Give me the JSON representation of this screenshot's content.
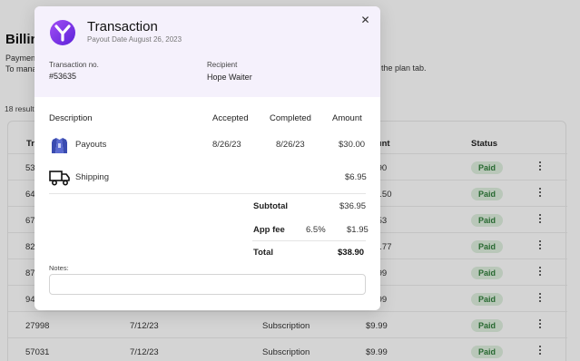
{
  "background": {
    "title": "Billin",
    "desc_line1": "Paymen",
    "desc_line2": "To mana",
    "desc_right": "the plan tab.",
    "results_count": "18 result",
    "headers": {
      "id": "Tra",
      "amount": "ount",
      "status": "Status"
    },
    "rows": [
      {
        "id": "53",
        "date": "",
        "type": "",
        "amount": ".90",
        "status": "Paid"
      },
      {
        "id": "64",
        "date": "",
        "type": "",
        "amount": "5.50",
        "status": "Paid"
      },
      {
        "id": "67",
        "date": "",
        "type": "",
        "amount": ".53",
        "status": "Paid"
      },
      {
        "id": "82",
        "date": "",
        "type": "",
        "amount": "3.77",
        "status": "Paid"
      },
      {
        "id": "87",
        "date": "",
        "type": "",
        "amount": ".99",
        "status": "Paid"
      },
      {
        "id": "94",
        "date": "",
        "type": "",
        "amount": ".99",
        "status": "Paid"
      },
      {
        "id": "27998",
        "date": "7/12/23",
        "type": "Subscription",
        "amount": "$9.99",
        "status": "Paid"
      },
      {
        "id": "57031",
        "date": "7/12/23",
        "type": "Subscription",
        "amount": "$9.99",
        "status": "Paid"
      }
    ]
  },
  "modal": {
    "title": "Transaction",
    "payout_date": "Payout Date August 26, 2023",
    "transaction_no_label": "Transaction no.",
    "transaction_no": "#53635",
    "recipient_label": "Recipient",
    "recipient": "Hope Waiter",
    "columns": {
      "description": "Description",
      "accepted": "Accepted",
      "completed": "Completed",
      "amount": "Amount"
    },
    "items": [
      {
        "icon": "jersey-icon",
        "description": "Payouts",
        "accepted": "8/26/23",
        "completed": "8/26/23",
        "amount": "$30.00"
      },
      {
        "icon": "truck-icon",
        "description": "Shipping",
        "accepted": "",
        "completed": "",
        "amount": "$6.95"
      }
    ],
    "subtotal_label": "Subtotal",
    "subtotal": "$36.95",
    "app_fee_label": "App fee",
    "app_fee_rate": "6.5%",
    "app_fee": "$1.95",
    "total_label": "Total",
    "total": "$38.90",
    "notes_label": "Notes:",
    "notes_value": ""
  },
  "colors": {
    "accent_purple": "#7b2ff0",
    "header_tint": "#f5f1fc",
    "paid_bg": "#dff0df",
    "paid_text": "#2f7d3a"
  }
}
